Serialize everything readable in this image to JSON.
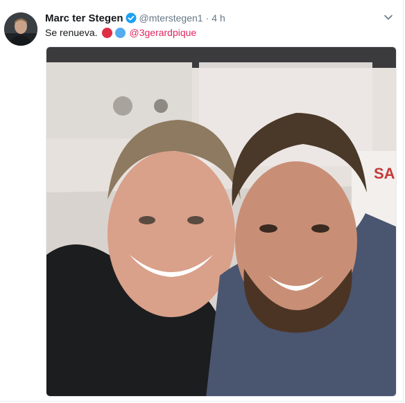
{
  "tweet": {
    "author_name": "Marc ter Stegen",
    "handle": "@mterstegen1",
    "separator": "·",
    "time": "4 h",
    "text": "Se renueva.",
    "mention": "@3gerardpique",
    "emojis": [
      "red-circle",
      "blue-circle"
    ]
  },
  "colors": {
    "mention": "#e0245e",
    "verified": "#1da1f2",
    "secondary_text": "#657786"
  },
  "icons": {
    "verified": "verified-badge-icon",
    "menu": "chevron-down-icon"
  }
}
